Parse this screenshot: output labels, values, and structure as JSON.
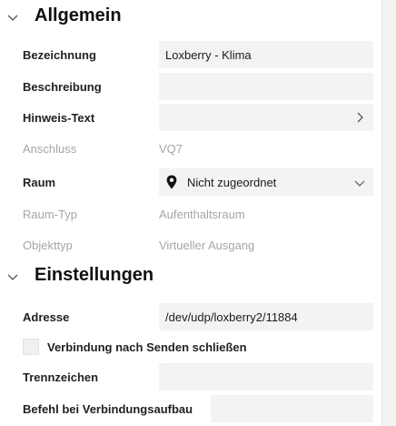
{
  "general": {
    "title": "Allgemein",
    "rows": {
      "name": {
        "label": "Bezeichnung",
        "value": "Loxberry - Klima"
      },
      "description": {
        "label": "Beschreibung",
        "value": ""
      },
      "hint": {
        "label": "Hinweis-Text",
        "value": ""
      },
      "connection": {
        "label": "Anschluss",
        "value": "VQ7"
      },
      "room": {
        "label": "Raum",
        "value": "Nicht zugeordnet"
      },
      "room_type": {
        "label": "Raum-Typ",
        "value": "Aufenthaltsraum"
      },
      "object_type": {
        "label": "Objekttyp",
        "value": "Virtueller Ausgang"
      }
    }
  },
  "settings": {
    "title": "Einstellungen",
    "rows": {
      "address": {
        "label": "Adresse",
        "value": "/dev/udp/loxberry2/11884"
      },
      "close_after_send": {
        "label": "Verbindung nach Senden schließen",
        "checked": false
      },
      "separator": {
        "label": "Trennzeichen",
        "value": ""
      },
      "connect_command": {
        "label": "Befehl bei Verbindungsaufbau",
        "value": ""
      }
    }
  },
  "icons": {
    "collapse": "chevron-down-icon",
    "expand_hint": "chevron-right-icon",
    "room_pin": "location-pin-icon"
  }
}
